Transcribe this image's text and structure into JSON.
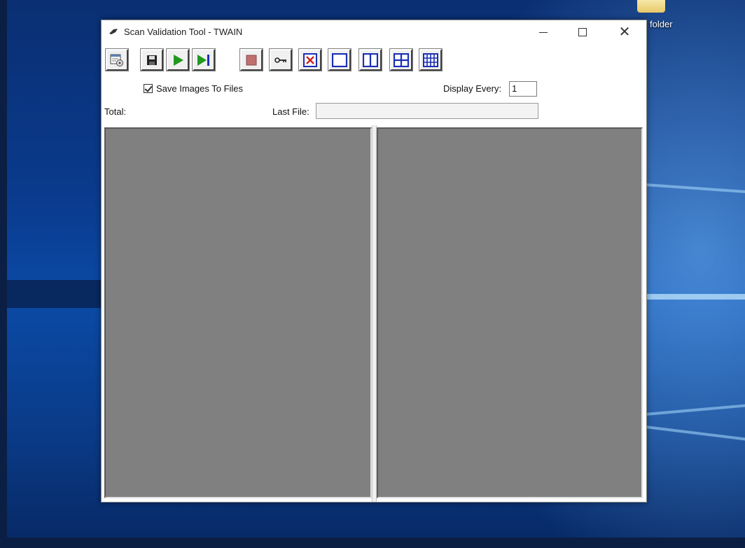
{
  "desktop": {
    "folder_label": "folder"
  },
  "window": {
    "title": "Scan Validation Tool - TWAIN",
    "controls": {
      "minimize": "minimize",
      "maximize": "maximize",
      "close": "close"
    }
  },
  "toolbar": {
    "buttons": [
      {
        "name": "settings-icon"
      },
      {
        "name": "save-icon"
      },
      {
        "name": "start-scan-icon"
      },
      {
        "name": "scan-one-page-icon"
      },
      {
        "name": "stop-icon"
      },
      {
        "name": "key-icon"
      },
      {
        "name": "no-display-icon"
      },
      {
        "name": "single-view-icon"
      },
      {
        "name": "dual-view-icon"
      },
      {
        "name": "quad-view-icon"
      },
      {
        "name": "multi-view-icon"
      }
    ]
  },
  "options": {
    "save_images_label": "Save Images To Files",
    "save_images_checked": true,
    "display_every_label": "Display Every:",
    "display_every_value": "1"
  },
  "status": {
    "total_label": "Total:",
    "last_file_label": "Last File:",
    "last_file_value": ""
  },
  "colors": {
    "pane_background": "#808080",
    "play_green": "#1f9a1f",
    "stop_red": "#c07070",
    "view_blue": "#1a2fb5",
    "close_red": "#d02020"
  }
}
